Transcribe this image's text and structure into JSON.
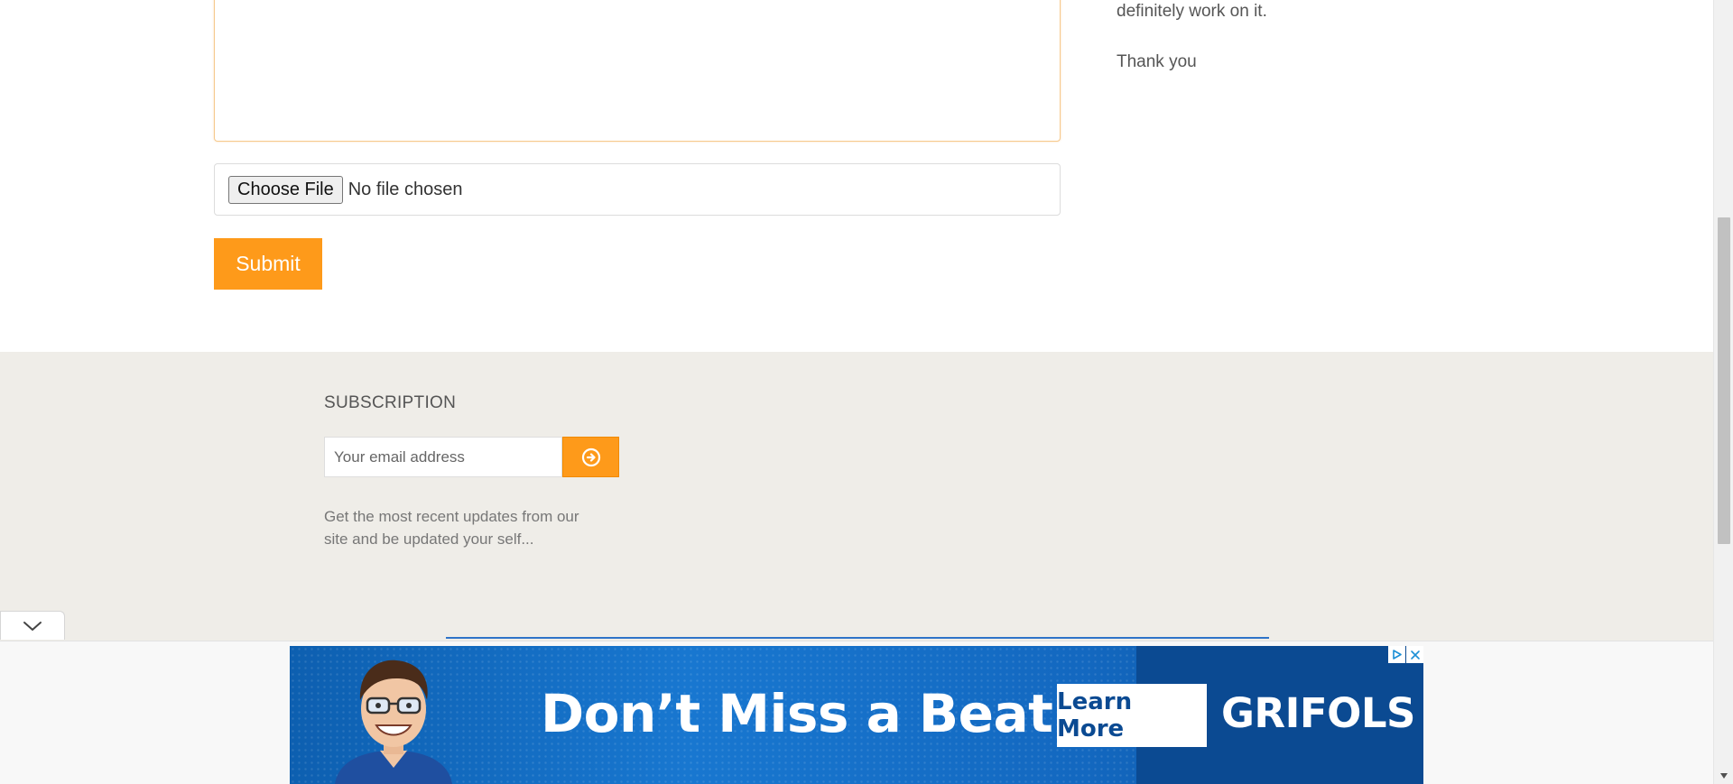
{
  "form": {
    "file_button_label": "Choose File",
    "file_status": "No file chosen",
    "submit_label": "Submit"
  },
  "side_text": {
    "line1": "definitely work on it.",
    "line2": "Thank you"
  },
  "footer": {
    "subscription_title": "SUBSCRIPTION",
    "email_placeholder": "Your email address",
    "description": "Get the most recent updates from our site and be updated your self..."
  },
  "ad": {
    "headline": "Don’t Miss a Beat",
    "cta": "Learn More",
    "brand": "GRIFOLS",
    "choice_icon": "ad-choices-icon",
    "close_icon": "close-icon"
  },
  "colors": {
    "accent_orange": "#fe9a1a",
    "footer_bg": "#efede8",
    "ad_blue": "#1368c0",
    "ad_dark_blue": "#0b4a92"
  }
}
